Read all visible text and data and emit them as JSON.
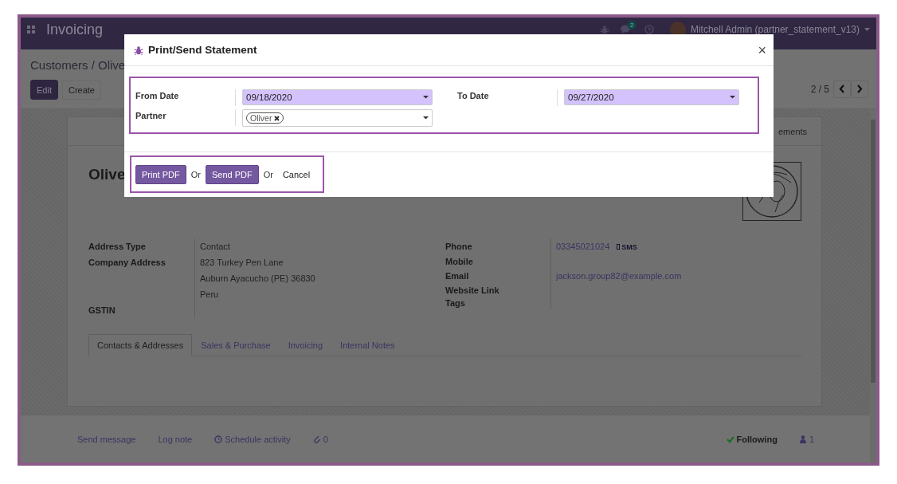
{
  "navbar": {
    "app_name": "Invoicing",
    "messages_badge": "2",
    "user": "Mitchell Admin (partner_statement_v13)"
  },
  "control_panel": {
    "breadcrumb": "Customers / Olive",
    "buttons": [
      {
        "label": "Edit",
        "kind": "primary"
      },
      {
        "label": "Create",
        "kind": "secondary"
      }
    ],
    "pager": "2 / 5"
  },
  "sheet": {
    "smart_button": "ements",
    "title": "Olive",
    "left_fields": [
      {
        "label": "Address Type",
        "lines": [
          "Contact"
        ]
      },
      {
        "label": "Company Address",
        "lines": [
          "823 Turkey Pen Lane",
          "Auburn  Ayacucho (PE)  36830",
          "Peru"
        ]
      },
      {
        "label": "GSTIN"
      }
    ],
    "right_fields": [
      {
        "label": "Phone",
        "lines": [
          "03345021024"
        ],
        "action": "SMS"
      },
      {
        "label": "Mobile"
      },
      {
        "label": "Email",
        "lines": [
          "jackson.group82@example.com"
        ]
      },
      {
        "label": "Website Link"
      },
      {
        "label": "Tags"
      }
    ],
    "tabs": [
      {
        "label": "Contacts & Addresses",
        "selected": true
      },
      {
        "label": "Sales & Purchase",
        "selected": false
      },
      {
        "label": "Invoicing",
        "selected": false
      },
      {
        "label": "Internal Notes",
        "selected": false
      }
    ]
  },
  "chatter": {
    "actions": [
      {
        "label": "Send message",
        "kind": "text"
      },
      {
        "label": "Log note",
        "kind": "text"
      },
      {
        "label": "Schedule activity",
        "kind": "clock"
      },
      {
        "label": "0",
        "kind": "attachment"
      }
    ],
    "following": "Following",
    "followers": "1"
  },
  "dialog": {
    "title": "Print/Send Statement",
    "close": "×",
    "fields": [
      {
        "label": "From Date",
        "kind": "date",
        "value": "09/18/2020"
      },
      {
        "label": "To Date",
        "kind": "date",
        "value": "09/27/2020"
      },
      {
        "label": "Partner",
        "kind": "tags",
        "tags": [
          "Oliver"
        ]
      }
    ],
    "footer": [
      {
        "kind": "button",
        "label": "Print PDF"
      },
      {
        "kind": "text",
        "label": "Or"
      },
      {
        "kind": "button",
        "label": "Send PDF"
      },
      {
        "kind": "text",
        "label": "Or"
      },
      {
        "kind": "link",
        "label": "Cancel"
      }
    ]
  }
}
